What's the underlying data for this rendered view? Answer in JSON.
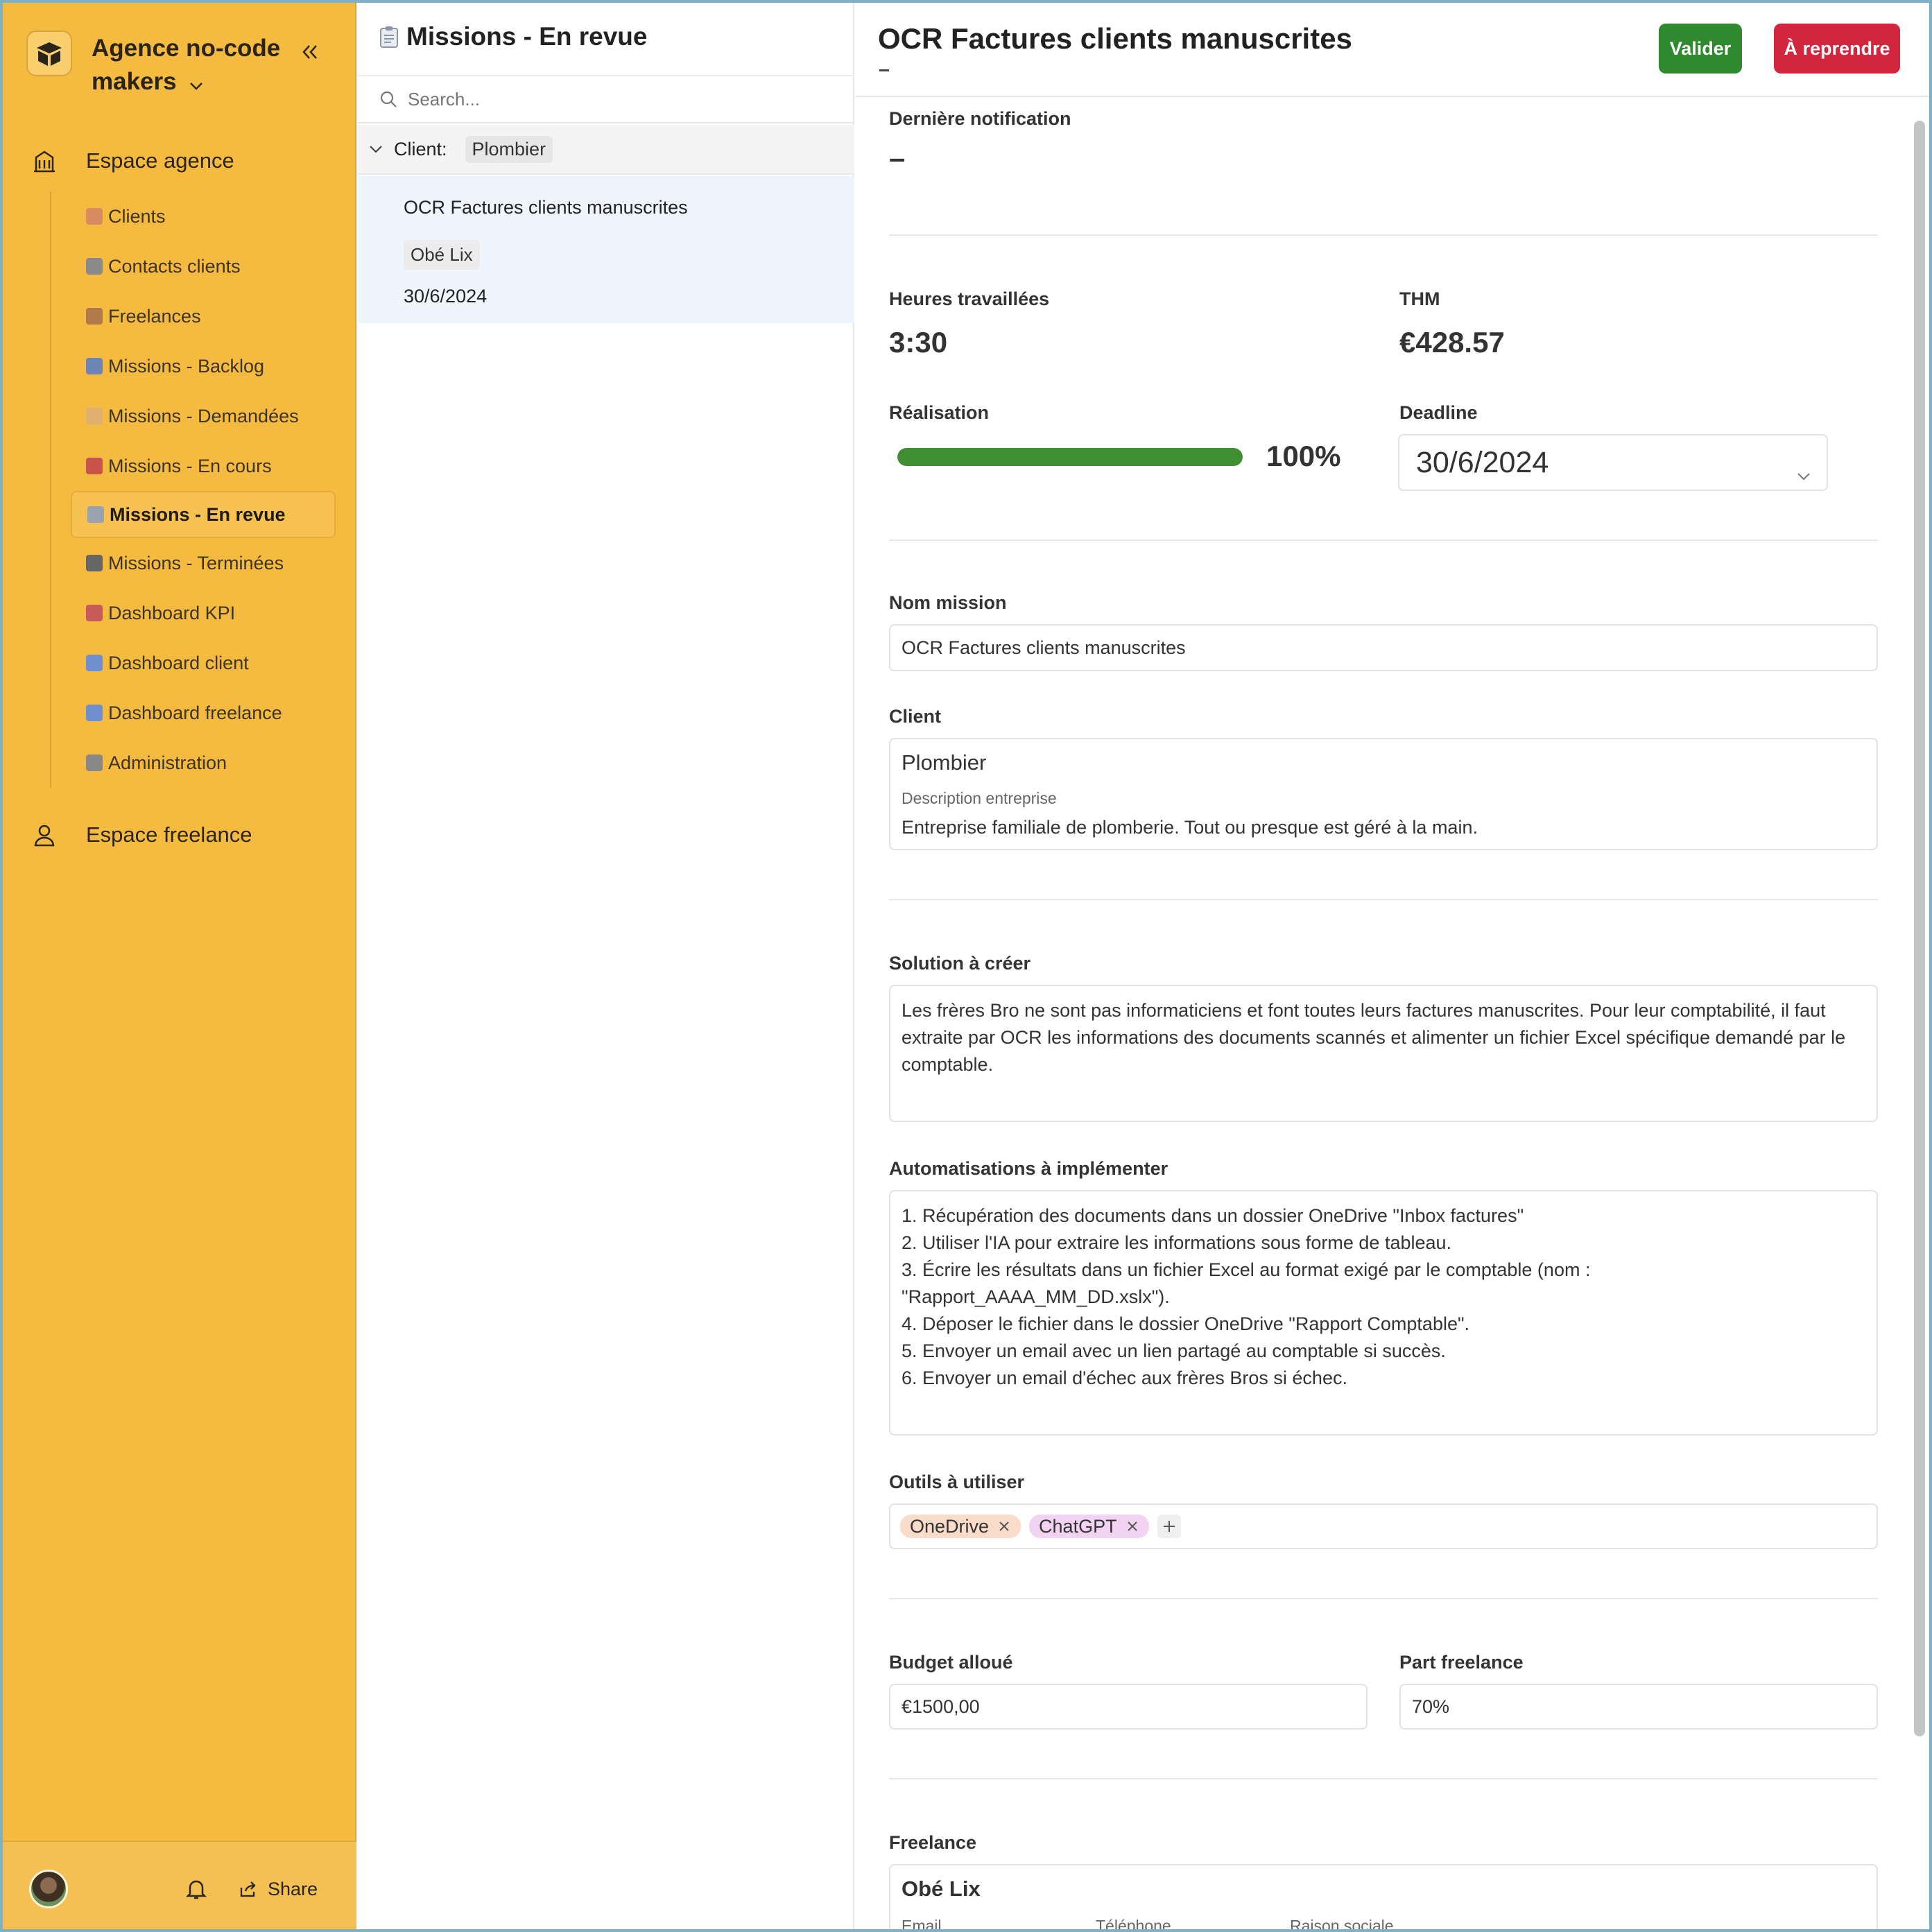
{
  "workspace": {
    "name": "Agence no-code makers"
  },
  "sidebar": {
    "section_agence": "Espace agence",
    "section_freelance": "Espace freelance",
    "items": [
      {
        "label": "Clients",
        "emoji_color": "#d98c5f"
      },
      {
        "label": "Contacts clients",
        "emoji_color": "#8a8a8a"
      },
      {
        "label": "Freelances",
        "emoji_color": "#b07a4a"
      },
      {
        "label": "Missions - Backlog",
        "emoji_color": "#6e84b5"
      },
      {
        "label": "Missions - Demandées",
        "emoji_color": "#e0b070"
      },
      {
        "label": "Missions - En cours",
        "emoji_color": "#c7534a"
      },
      {
        "label": "Missions - En revue",
        "emoji_color": "#9aa4b0",
        "active": true
      },
      {
        "label": "Missions - Terminées",
        "emoji_color": "#666"
      },
      {
        "label": "Dashboard KPI",
        "emoji_color": "#c95a5a"
      },
      {
        "label": "Dashboard client",
        "emoji_color": "#6f8fcf"
      },
      {
        "label": "Dashboard freelance",
        "emoji_color": "#6f8fcf"
      },
      {
        "label": "Administration",
        "emoji_color": "#888"
      }
    ],
    "share_label": "Share"
  },
  "list": {
    "title": "Missions - En revue",
    "search_placeholder": "Search...",
    "group_label": "Client:",
    "group_value": "Plombier",
    "record": {
      "title": "OCR Factures clients manuscrites",
      "freelance": "Obé Lix",
      "date": "30/6/2024"
    }
  },
  "detail": {
    "title": "OCR Factures clients manuscrites",
    "btn_validate": "Valider",
    "btn_rework": "À reprendre",
    "last_notif_label": "Dernière notification",
    "last_notif_value": "–",
    "hours_label": "Heures travaillées",
    "hours_value": "3:30",
    "thm_label": "THM",
    "thm_value": "€428.57",
    "realisation_label": "Réalisation",
    "realisation_pct": "100%",
    "realisation_fraction": 1.0,
    "deadline_label": "Deadline",
    "deadline_value": "30/6/2024",
    "nom_label": "Nom mission",
    "nom_value": "OCR Factures clients manuscrites",
    "client_label": "Client",
    "client_name": "Plombier",
    "client_desc_label": "Description entreprise",
    "client_desc": "Entreprise familiale de plomberie. Tout ou presque est géré à la main.",
    "solution_label": "Solution à créer",
    "solution_text": "Les frères Bro ne sont pas informaticiens et font toutes leurs factures manuscrites. Pour leur comptabilité, il faut extraite par OCR les informations des documents scannés et alimenter un fichier Excel spécifique demandé par le comptable.",
    "automations_label": "Automatisations à implémenter",
    "automations": [
      "1. Récupération des documents dans un dossier OneDrive \"Inbox factures\"",
      "2. Utiliser l'IA pour extraire les informations sous forme de tableau.",
      "3. Écrire les résultats dans un fichier Excel au format exigé par le comptable (nom :",
      "\"Rapport_AAAA_MM_DD.xslx\").",
      "4. Déposer le fichier dans le dossier OneDrive \"Rapport Comptable\".",
      "5. Envoyer un email avec un lien partagé au comptable si succès.",
      "6. Envoyer un email d'échec aux frères Bros si échec."
    ],
    "tools_label": "Outils à utiliser",
    "tools": [
      {
        "label": "OneDrive",
        "color": "#fadccb"
      },
      {
        "label": "ChatGPT",
        "color": "#f2d3f2"
      }
    ],
    "budget_label": "Budget alloué",
    "budget_value": "€1500,00",
    "part_label": "Part freelance",
    "part_value": "70%",
    "freelance_label": "Freelance",
    "freelance_name": "Obé Lix",
    "freelance_email_label": "Email",
    "freelance_phone_label": "Téléphone",
    "freelance_company_label": "Raison sociale"
  },
  "colors": {
    "sidebar_bg": "#f4bb40",
    "validate": "#2f8a2f",
    "rework": "#d1263d",
    "progress": "#3d8f2f"
  }
}
